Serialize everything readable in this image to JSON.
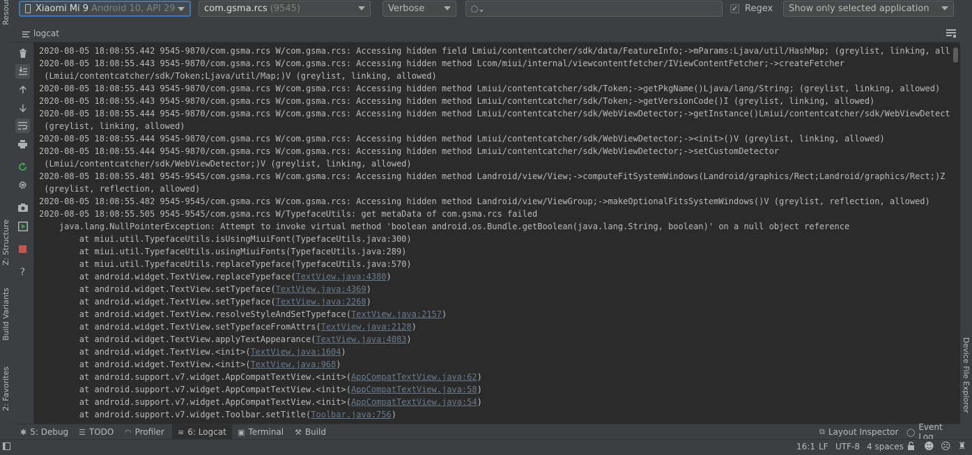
{
  "toolbar": {
    "device_name": "Xiaomi Mi 9",
    "device_api": "Android 10, API 29",
    "process_name": "com.gsma.rcs",
    "process_pid": "(9545)",
    "log_level": "Verbose",
    "search_value": "",
    "regex_label": "Regex",
    "regex_checked": true,
    "filter_option": "Show only selected application"
  },
  "header": {
    "title": "logcat"
  },
  "left_strip": {
    "resource_manager": "Resource Manager",
    "structure": "Z: Structure",
    "build_variants": "Build Variants",
    "favorites": "2: Favorites"
  },
  "right_strip": {
    "device_file_explorer": "Device File Explorer"
  },
  "log": {
    "lines": [
      {
        "pre": "2020-08-05 18:08:55.442 9545-9870/com.gsma.rcs W/com.gsma.rcs: Accessing hidden field Lmiui/contentcatcher/sdk/data/FeatureInfo;->mParams:Ljava/util/HashMap; (greylist, linking, allowed)",
        "link": "",
        "post": ""
      },
      {
        "pre": "2020-08-05 18:08:55.443 9545-9870/com.gsma.rcs W/com.gsma.rcs: Accessing hidden method Lcom/miui/internal/viewcontentfetcher/IViewContentFetcher;->createFetcher",
        "link": "",
        "post": ""
      },
      {
        "pre": " (Lmiui/contentcatcher/sdk/Token;Ljava/util/Map;)V (greylist, linking, allowed)",
        "link": "",
        "post": ""
      },
      {
        "pre": "2020-08-05 18:08:55.443 9545-9870/com.gsma.rcs W/com.gsma.rcs: Accessing hidden method Lmiui/contentcatcher/sdk/Token;->getPkgName()Ljava/lang/String; (greylist, linking, allowed)",
        "link": "",
        "post": ""
      },
      {
        "pre": "2020-08-05 18:08:55.443 9545-9870/com.gsma.rcs W/com.gsma.rcs: Accessing hidden method Lmiui/contentcatcher/sdk/Token;->getVersionCode()I (greylist, linking, allowed)",
        "link": "",
        "post": ""
      },
      {
        "pre": "2020-08-05 18:08:55.444 9545-9870/com.gsma.rcs W/com.gsma.rcs: Accessing hidden method Lmiui/contentcatcher/sdk/WebViewDetector;->getInstance()Lmiui/contentcatcher/sdk/WebViewDetector;",
        "link": "",
        "post": ""
      },
      {
        "pre": " (greylist, linking, allowed)",
        "link": "",
        "post": ""
      },
      {
        "pre": "2020-08-05 18:08:55.444 9545-9870/com.gsma.rcs W/com.gsma.rcs: Accessing hidden method Lmiui/contentcatcher/sdk/WebViewDetector;-><init>()V (greylist, linking, allowed)",
        "link": "",
        "post": ""
      },
      {
        "pre": "2020-08-05 18:08:55.444 9545-9870/com.gsma.rcs W/com.gsma.rcs: Accessing hidden method Lmiui/contentcatcher/sdk/WebViewDetector;->setCustomDetector",
        "link": "",
        "post": ""
      },
      {
        "pre": " (Lmiui/contentcatcher/sdk/WebViewDetector;)V (greylist, linking, allowed)",
        "link": "",
        "post": ""
      },
      {
        "pre": "2020-08-05 18:08:55.481 9545-9545/com.gsma.rcs W/com.gsma.rcs: Accessing hidden method Landroid/view/View;->computeFitSystemWindows(Landroid/graphics/Rect;Landroid/graphics/Rect;)Z",
        "link": "",
        "post": ""
      },
      {
        "pre": " (greylist, reflection, allowed)",
        "link": "",
        "post": ""
      },
      {
        "pre": "2020-08-05 18:08:55.482 9545-9545/com.gsma.rcs W/com.gsma.rcs: Accessing hidden method Landroid/view/ViewGroup;->makeOptionalFitsSystemWindows()V (greylist, reflection, allowed)",
        "link": "",
        "post": ""
      },
      {
        "pre": "2020-08-05 18:08:55.505 9545-9545/com.gsma.rcs W/TypefaceUtils: get metaData of com.gsma.rcs failed",
        "link": "",
        "post": ""
      },
      {
        "pre": "    java.lang.NullPointerException: Attempt to invoke virtual method 'boolean android.os.Bundle.getBoolean(java.lang.String, boolean)' on a null object reference",
        "link": "",
        "post": ""
      },
      {
        "pre": "        at miui.util.TypefaceUtils.isUsingMiuiFont(TypefaceUtils.java:300)",
        "link": "",
        "post": ""
      },
      {
        "pre": "        at miui.util.TypefaceUtils.usingMiuiFonts(TypefaceUtils.java:289)",
        "link": "",
        "post": ""
      },
      {
        "pre": "        at miui.util.TypefaceUtils.replaceTypeface(TypefaceUtils.java:570)",
        "link": "",
        "post": ""
      },
      {
        "pre": "        at android.widget.TextView.replaceTypeface(",
        "link": "TextView.java:4380",
        "post": ")"
      },
      {
        "pre": "        at android.widget.TextView.setTypeface(",
        "link": "TextView.java:4369",
        "post": ")"
      },
      {
        "pre": "        at android.widget.TextView.setTypeface(",
        "link": "TextView.java:2268",
        "post": ")"
      },
      {
        "pre": "        at android.widget.TextView.resolveStyleAndSetTypeface(",
        "link": "TextView.java:2157",
        "post": ")"
      },
      {
        "pre": "        at android.widget.TextView.setTypefaceFromAttrs(",
        "link": "TextView.java:2128",
        "post": ")"
      },
      {
        "pre": "        at android.widget.TextView.applyTextAppearance(",
        "link": "TextView.java:4083",
        "post": ")"
      },
      {
        "pre": "        at android.widget.TextView.<init>(",
        "link": "TextView.java:1604",
        "post": ")"
      },
      {
        "pre": "        at android.widget.TextView.<init>(",
        "link": "TextView.java:968",
        "post": ")"
      },
      {
        "pre": "        at android.support.v7.widget.AppCompatTextView.<init>(",
        "link": "AppCompatTextView.java:62",
        "post": ")"
      },
      {
        "pre": "        at android.support.v7.widget.AppCompatTextView.<init>(",
        "link": "AppCompatTextView.java:58",
        "post": ")"
      },
      {
        "pre": "        at android.support.v7.widget.AppCompatTextView.<init>(",
        "link": "AppCompatTextView.java:54",
        "post": ")"
      },
      {
        "pre": "        at android.support.v7.widget.Toolbar.setTitle(",
        "link": "Toolbar.java:756",
        "post": ")"
      }
    ]
  },
  "bottom_tabs": [
    {
      "label": "5: Debug",
      "icon": "bug-icon",
      "active": false
    },
    {
      "label": "TODO",
      "icon": "list-icon",
      "active": false
    },
    {
      "label": "Profiler",
      "icon": "gauge-icon",
      "active": false
    },
    {
      "label": "6: Logcat",
      "icon": "logcat-icon",
      "active": true
    },
    {
      "label": "Terminal",
      "icon": "terminal-icon",
      "active": false
    },
    {
      "label": "Build",
      "icon": "hammer-icon",
      "active": false
    }
  ],
  "bottom_right_tabs": {
    "layout_inspector": "Layout Inspector",
    "event_log": "Event Log"
  },
  "status": {
    "position": "16:1",
    "line_sep": "LF",
    "encoding": "UTF-8",
    "indent": "4 spaces"
  },
  "colors": {
    "background": "#2b2b2b",
    "panel": "#3c3f41",
    "focus": "#3d7ab9",
    "link": "#6a7b8c",
    "stop_red": "#c75450",
    "run_green": "#499c54"
  }
}
